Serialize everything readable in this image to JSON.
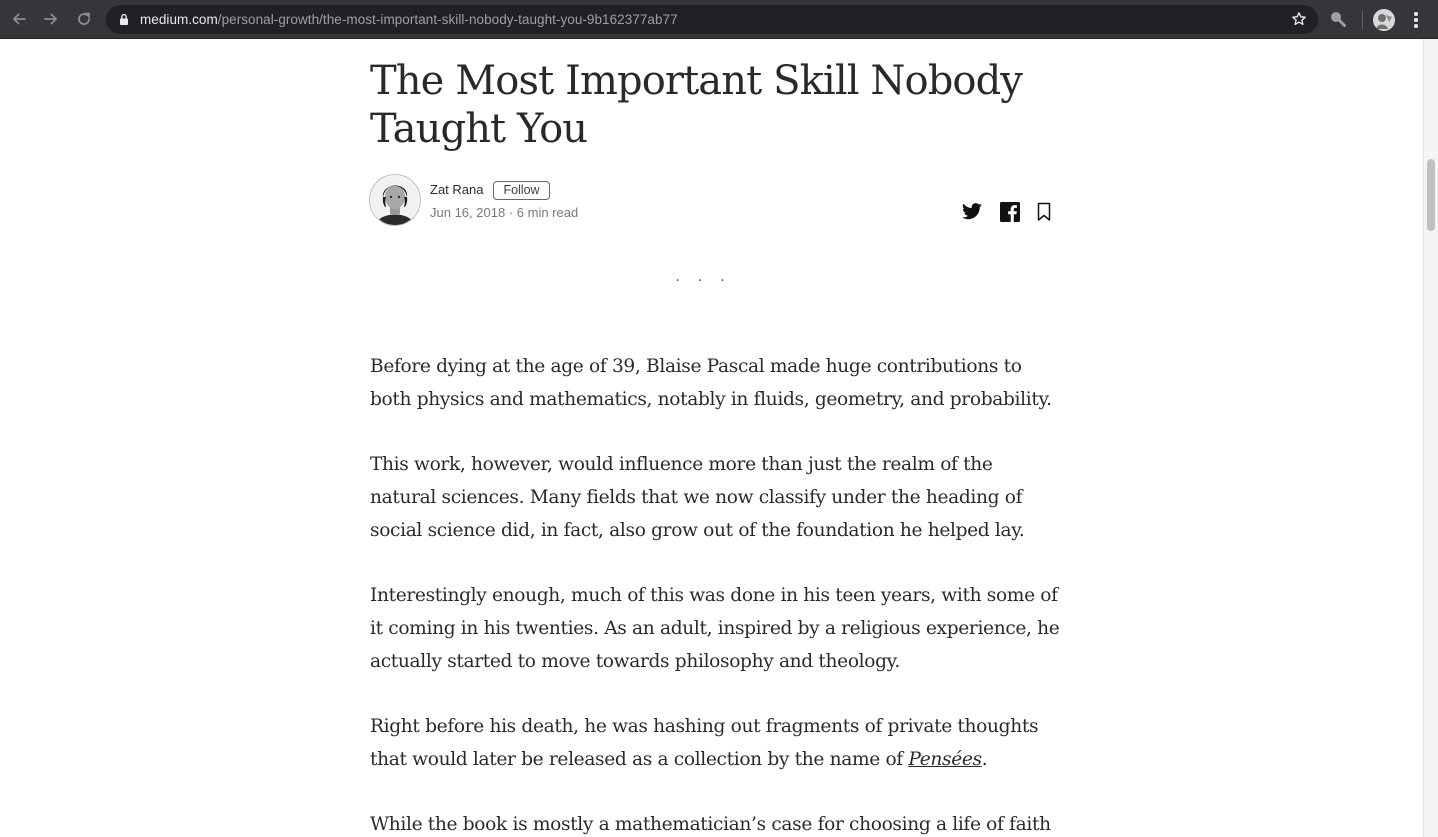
{
  "browser": {
    "url_host": "medium.com",
    "url_path": "/personal-growth/the-most-important-skill-nobody-taught-you-9b162377ab77",
    "icons": {
      "back": "arrow-left-icon",
      "forward": "arrow-right-icon",
      "reload": "reload-icon",
      "secure": "lock-icon",
      "bookmark": "star-icon",
      "extension": "magnifier-icon",
      "profile": "avatar",
      "menu": "kebab-menu-icon"
    },
    "colors": {
      "toolbar": "#35363a",
      "omnibox": "#202124"
    }
  },
  "article": {
    "title": "The Most Important Skill Nobody Taught You",
    "author": {
      "name": "Zat Rana",
      "follow_label": "Follow",
      "date": "Jun 16, 2018",
      "meta_separator": "·",
      "read_time": "6 min read"
    },
    "share_icons": [
      "twitter-icon",
      "facebook-icon",
      "bookmark-icon"
    ],
    "section_separator": "...",
    "paragraphs": [
      "Before dying at the age of 39, Blaise Pascal made huge contributions to both physics and mathematics, notably in fluids, geometry, and probability.",
      "This work, however, would influence more than just the realm of the natural sciences. Many fields that we now classify under the heading of social science did, in fact, also grow out of the foundation he helped lay.",
      "Interestingly enough, much of this was done in his teen years, with some of it coming in his twenties. As an adult, inspired by a religious experience, he actually started to move towards philosophy and theology."
    ],
    "paragraph4": {
      "before": "Right before his death, he was hashing out fragments of private thoughts that would later be released as a collection by the name of ",
      "link": "Pensées",
      "after": "."
    },
    "paragraph5": "While the book is mostly a mathematician’s case for choosing a life of faith"
  }
}
